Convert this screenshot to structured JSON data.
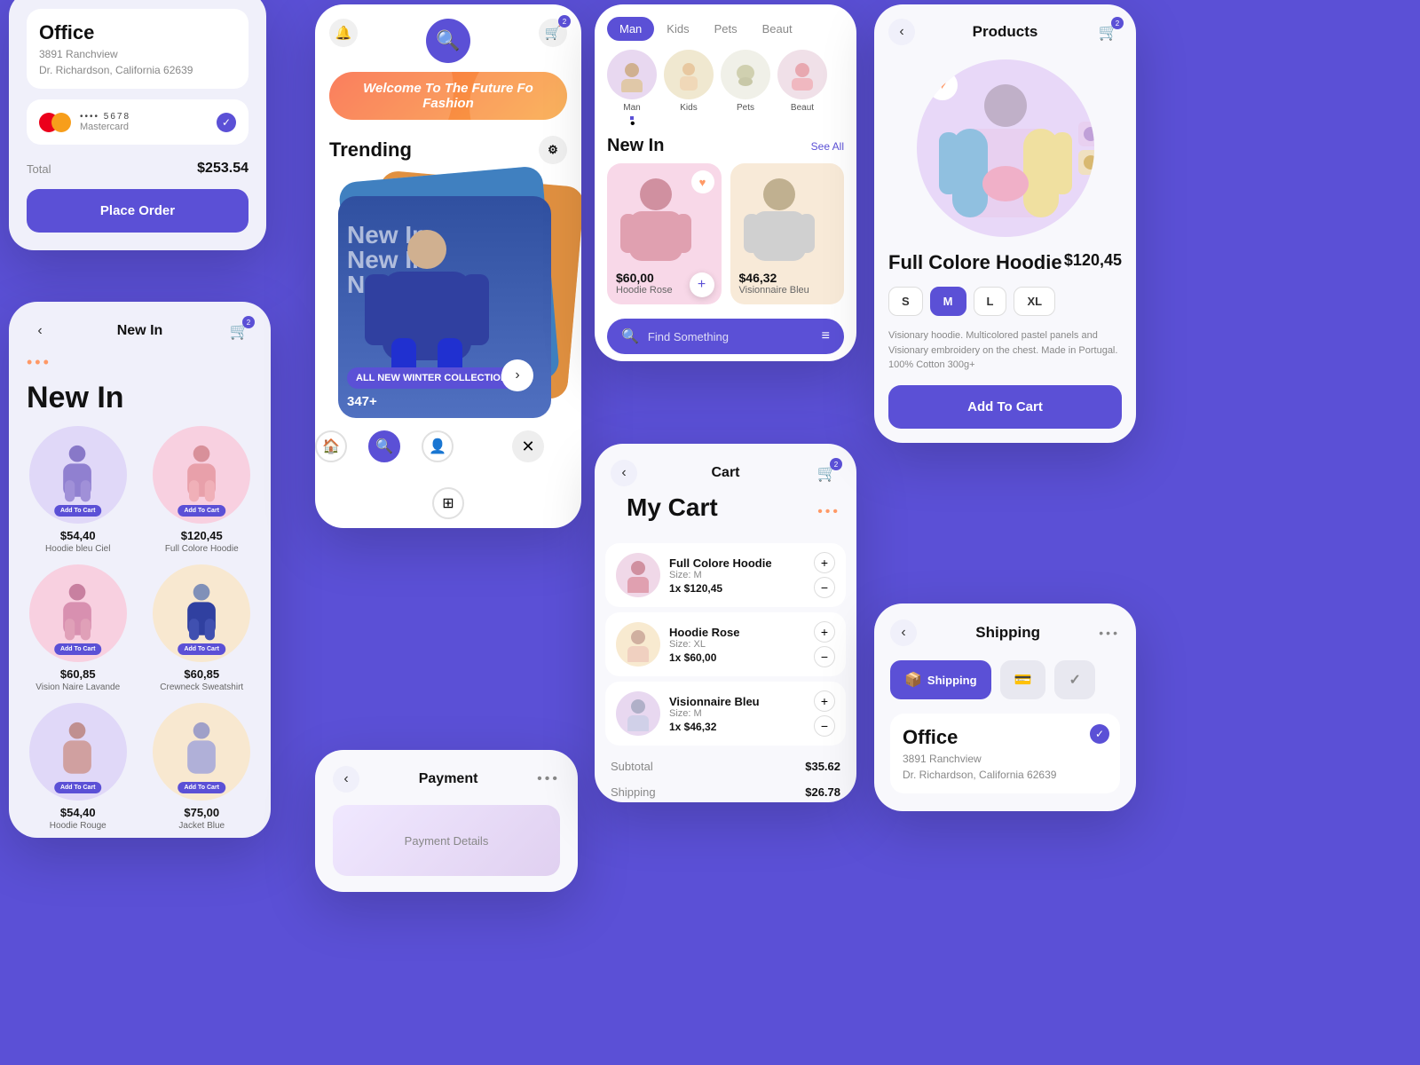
{
  "checkout": {
    "office_title": "Office",
    "address": "3891 Ranchview",
    "city_state": "Dr. Richardson, California 62639",
    "card_dots": "•••• 5678",
    "card_label": "Mastercard",
    "total_label": "Total",
    "total_amount": "$253.54",
    "place_order_label": "Place Order"
  },
  "newin": {
    "header_title": "New In",
    "page_title": "New In",
    "cart_badge": "2",
    "products": [
      {
        "price": "$54,40",
        "name": "Hoodie bleu Ciel",
        "bg": "lavender-bg"
      },
      {
        "price": "$120,45",
        "name": "Full Colore Hoodie",
        "bg": "pink-bg"
      },
      {
        "price": "$60,85",
        "name": "Vision Naire Lavande",
        "bg": "pink-bg"
      },
      {
        "price": "$60,85",
        "name": "Crewneck Sweatshirt",
        "bg": "peach-bg"
      },
      {
        "price": "$54,40",
        "name": "Hoodie Rouge",
        "bg": "lavender-bg"
      },
      {
        "price": "$75,00",
        "name": "Jacket Blue",
        "bg": "peach-bg"
      }
    ],
    "add_to_cart": "Add To Cart"
  },
  "trending": {
    "header_icons": [
      "🔔",
      "🛒"
    ],
    "banner_text": "Welcome To The Future Fo Fashion",
    "section_title": "Trending",
    "cards": [
      {
        "overlay": "New In",
        "bottom_label": "ALL NEW WINTER COLLECTION"
      },
      {
        "overlay": "New In",
        "bottom_label": "ALL NEW WINTER COLLECTION"
      }
    ],
    "count": "347+",
    "close_icon": "✕",
    "bottom_icons": [
      "🏠",
      "🔍",
      "👤",
      "⊞"
    ]
  },
  "payment": {
    "header_title": "Payment",
    "back_icon": "‹",
    "menu_icon": "•••"
  },
  "fashion": {
    "categories": [
      {
        "label": "Man",
        "active": true
      },
      {
        "label": "Kids",
        "active": false
      },
      {
        "label": "Pets",
        "active": false
      },
      {
        "label": "Beaut",
        "active": false
      }
    ],
    "section_title": "New In",
    "see_all": "See All",
    "products": [
      {
        "price": "$60,00",
        "name": "Hoodie Rose",
        "card_class": "pink-card"
      },
      {
        "price": "$46,32",
        "name": "Visionnaire Bleu",
        "card_class": "peach-card"
      }
    ],
    "search_placeholder": "Find Something"
  },
  "cart": {
    "header_title": "Cart",
    "cart_badge": "2",
    "title": "My Cart",
    "items": [
      {
        "name": "Full Colore Hoodie",
        "size": "Size: M",
        "qty": "1x",
        "price": "$120,45",
        "img_bg": "pink"
      },
      {
        "name": "Hoodie Rose",
        "size": "Size: XL",
        "qty": "1x",
        "price": "$60,00",
        "img_bg": "peach"
      },
      {
        "name": "Visionnaire Bleu",
        "size": "Size: M",
        "qty": "1x",
        "price": "$46,32",
        "img_bg": "lavender"
      }
    ],
    "subtotal_label": "Subtotal",
    "subtotal_value": "$35.62",
    "shipping_label": "Shipping",
    "shipping_value": "$26.78"
  },
  "products": {
    "header_title": "Products",
    "back_icon": "‹",
    "product_name": "Full Colore Hoodie",
    "product_price": "$120,45",
    "sizes": [
      "S",
      "M",
      "L",
      "XL"
    ],
    "active_size": "M",
    "description": "Visionary hoodie. Multicolored pastel panels and Visionary embroidery on the chest. Made in Portugal. 100% Cotton 300g+",
    "add_to_cart": "Add To Cart"
  },
  "shipping": {
    "back_icon": "‹",
    "header_title": "Shipping",
    "menu_icon": "•••",
    "steps": [
      {
        "label": "Shipping",
        "icon": "📦",
        "active": true
      },
      {
        "label": "",
        "icon": "💳",
        "active": false
      },
      {
        "label": "",
        "icon": "✓",
        "active": false
      }
    ],
    "office_title": "Office",
    "address": "3891 Ranchview",
    "city_state": "Dr. Richardson, California 62639"
  }
}
